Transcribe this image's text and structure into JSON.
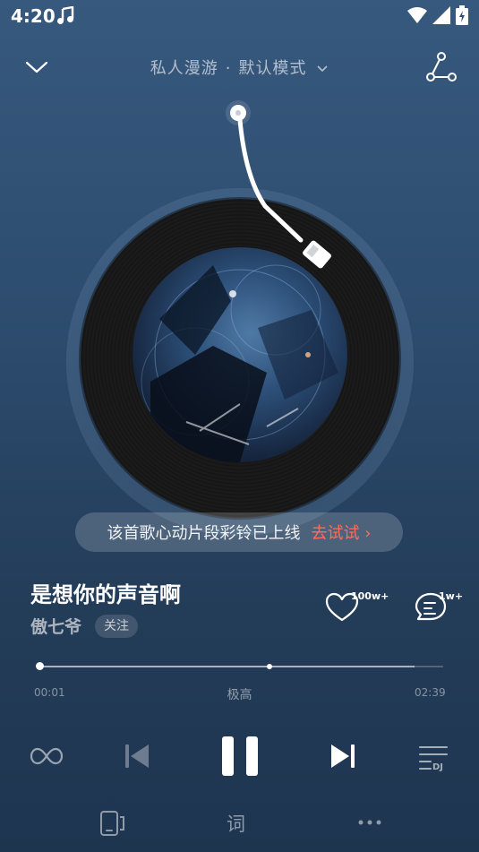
{
  "status_bar": {
    "time": "4:20",
    "icons": [
      "music-note-icon",
      "wifi-icon",
      "signal-icon",
      "battery-charging-icon"
    ]
  },
  "header": {
    "mode": "私人漫游",
    "separator": "·",
    "submode": "默认模式",
    "icons": [
      "chevron-down-icon",
      "share-icon"
    ]
  },
  "banner": {
    "text": "该首歌心动片段彩铃已上线",
    "action": "去试试 ›"
  },
  "song": {
    "title": "是想你的声音啊",
    "artist": "傲七爷",
    "follow_label": "关注",
    "like_count": "100w+",
    "comment_count": "1w+"
  },
  "playback": {
    "current_time": "00:01",
    "total_time": "02:39",
    "quality": "极高",
    "progress_fraction": 0.006,
    "buffer_fraction": 0.93,
    "state": "playing"
  },
  "controls": {
    "icons": [
      "loop-icon",
      "previous-icon",
      "pause-icon",
      "next-icon",
      "dj-playlist-icon"
    ]
  },
  "bottom_actions": {
    "lyrics_label": "词",
    "icons": [
      "device-icon",
      "more-icon"
    ]
  },
  "colors": {
    "accent_red": "#ff6d5e",
    "background_top": "#37597e",
    "background_bottom": "#1e3550"
  }
}
